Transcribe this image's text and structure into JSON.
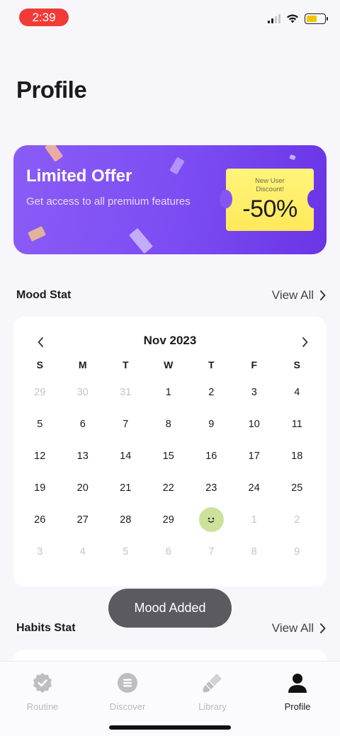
{
  "status": {
    "time": "2:39",
    "battery_color": "#f5c400"
  },
  "page": {
    "title": "Profile"
  },
  "offer": {
    "title": "Limited Offer",
    "subtitle": "Get access to all premium features",
    "ticket_small": "New User Discount!",
    "ticket_big": "-50%",
    "colors": {
      "start": "#8a5cf6",
      "end": "#6a34e6",
      "ticket": "#fff47a"
    }
  },
  "mood_stat": {
    "title": "Mood Stat",
    "view_all": "View All"
  },
  "calendar": {
    "month": "Nov 2023",
    "weekdays": [
      "S",
      "M",
      "T",
      "W",
      "T",
      "F",
      "S"
    ],
    "weeks": [
      [
        "29",
        "30",
        "31",
        "1",
        "2",
        "3",
        "4"
      ],
      [
        "5",
        "6",
        "7",
        "8",
        "9",
        "10",
        "11"
      ],
      [
        "12",
        "13",
        "14",
        "15",
        "16",
        "17",
        "18"
      ],
      [
        "19",
        "20",
        "21",
        "22",
        "23",
        "24",
        "25"
      ],
      [
        "26",
        "27",
        "28",
        "29",
        "",
        "1",
        "2"
      ],
      [
        "3",
        "4",
        "5",
        "6",
        "7",
        "8",
        "9"
      ]
    ],
    "mood_day_color": "#cde19a"
  },
  "toast": {
    "text": "Mood Added"
  },
  "habits_stat": {
    "title": "Habits Stat",
    "view_all": "View All"
  },
  "tabs": [
    {
      "label": "Routine",
      "icon": "badge-check-icon"
    },
    {
      "label": "Discover",
      "icon": "list-circle-icon"
    },
    {
      "label": "Library",
      "icon": "brush-icon"
    },
    {
      "label": "Profile",
      "icon": "user-icon"
    }
  ]
}
